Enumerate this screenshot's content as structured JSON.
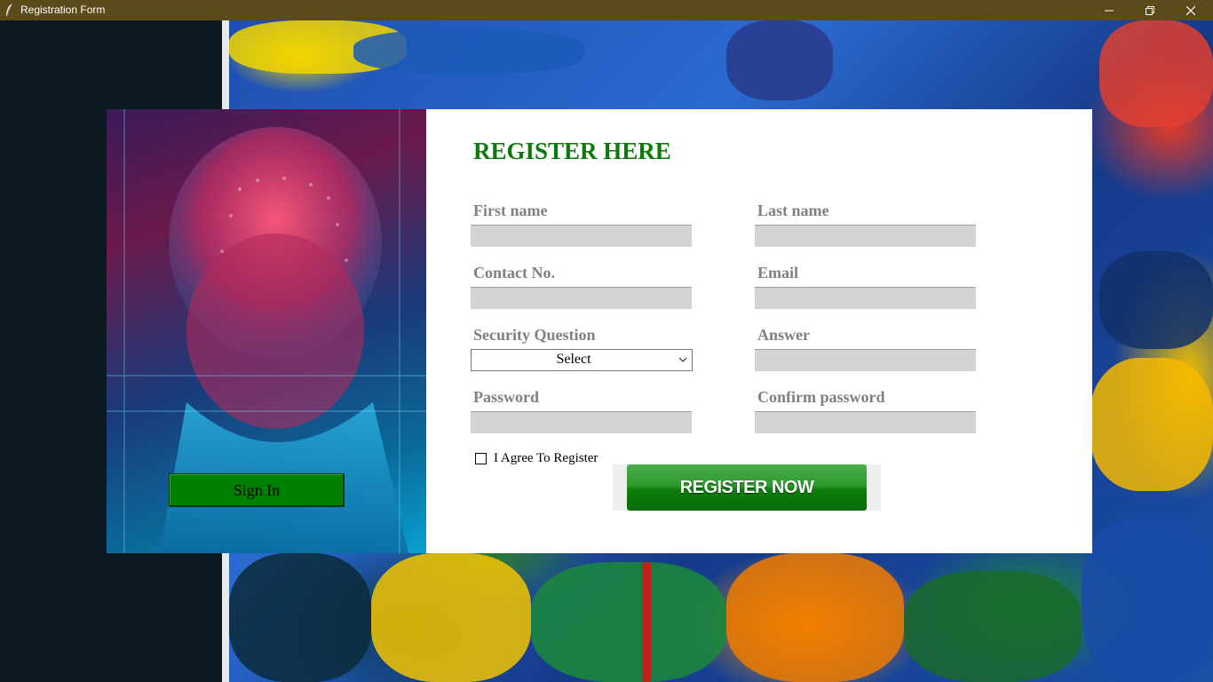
{
  "window": {
    "title": "Registration Form",
    "controls": {
      "minimize": "minimize-icon",
      "maximize": "restore-icon",
      "close": "close-icon"
    }
  },
  "colors": {
    "titlebar": "#5b4a1a",
    "heading": "#0a7a0a",
    "label": "#808080",
    "input_bg": "#d3d3d3",
    "signin_bg": "#008000",
    "register_bg": "#0b7e0b"
  },
  "left_panel": {
    "signin_label": "Sign In"
  },
  "form": {
    "title": "REGISTER HERE",
    "first_name": {
      "label": "First name",
      "value": ""
    },
    "last_name": {
      "label": "Last name",
      "value": ""
    },
    "contact": {
      "label": "Contact No.",
      "value": ""
    },
    "email": {
      "label": "Email",
      "value": ""
    },
    "security_question": {
      "label": "Security Question",
      "selected": "Select"
    },
    "answer": {
      "label": "Answer",
      "value": ""
    },
    "password": {
      "label": "Password",
      "value": ""
    },
    "confirm_password": {
      "label": "Confirm password",
      "value": ""
    },
    "agree_label": "I Agree To Register",
    "agree_checked": false,
    "register_label": "REGISTER NOW"
  }
}
